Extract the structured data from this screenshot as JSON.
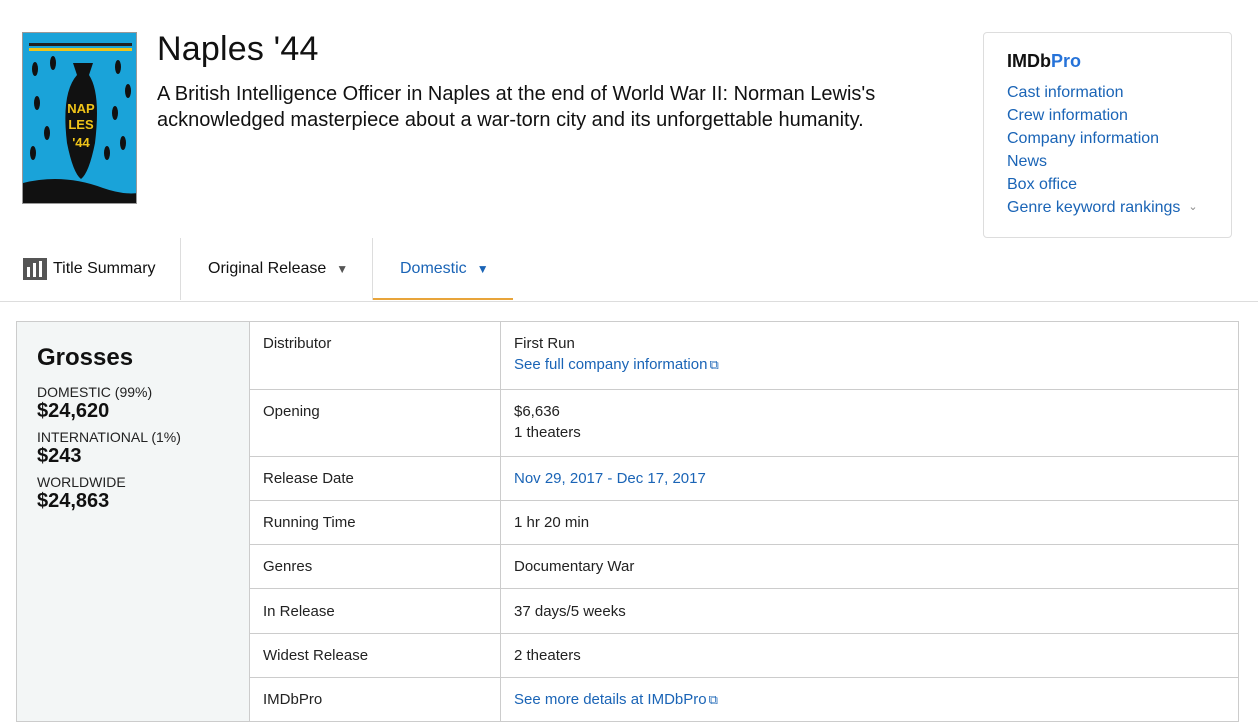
{
  "title": "Naples '44",
  "summary": "A British Intelligence Officer in Naples at the end of World War II: Norman Lewis's acknowledged masterpiece about a war-torn city and its unforgettable humanity.",
  "poster": {
    "title_text": "NAPLES '44"
  },
  "imdbpro": {
    "logo_main": "IMDb",
    "logo_pro": "Pro",
    "links": [
      "Cast information",
      "Crew information",
      "Company information",
      "News",
      "Box office",
      "Genre keyword rankings"
    ]
  },
  "tabs": [
    {
      "label": "Title Summary"
    },
    {
      "label": "Original Release"
    },
    {
      "label": "Domestic"
    }
  ],
  "grosses": {
    "heading": "Grosses",
    "domestic_label": "DOMESTIC (99%)",
    "domestic_value": "$24,620",
    "international_label": "INTERNATIONAL (1%)",
    "international_value": "$243",
    "worldwide_label": "WORLDWIDE",
    "worldwide_value": "$24,863"
  },
  "details": {
    "distributor_label": "Distributor",
    "distributor_value": "First Run",
    "distributor_link": "See full company information",
    "opening_label": "Opening",
    "opening_value": "$6,636",
    "opening_theaters": "1 theaters",
    "release_label": "Release Date",
    "release_start": "Nov 29, 2017",
    "release_sep": " - ",
    "release_end": "Dec 17, 2017",
    "running_label": "Running Time",
    "running_value": "1 hr 20 min",
    "genres_label": "Genres",
    "genres_value": "Documentary War",
    "inrelease_label": "In Release",
    "inrelease_value": "37 days/5 weeks",
    "widest_label": "Widest Release",
    "widest_value": "2 theaters",
    "imdbpro_label": "IMDbPro",
    "imdbpro_link": "See more details at IMDbPro"
  },
  "colors": {
    "link": "#1a64b6",
    "tab_underline": "#e8a43a",
    "pro_accent": "#2673d9"
  }
}
